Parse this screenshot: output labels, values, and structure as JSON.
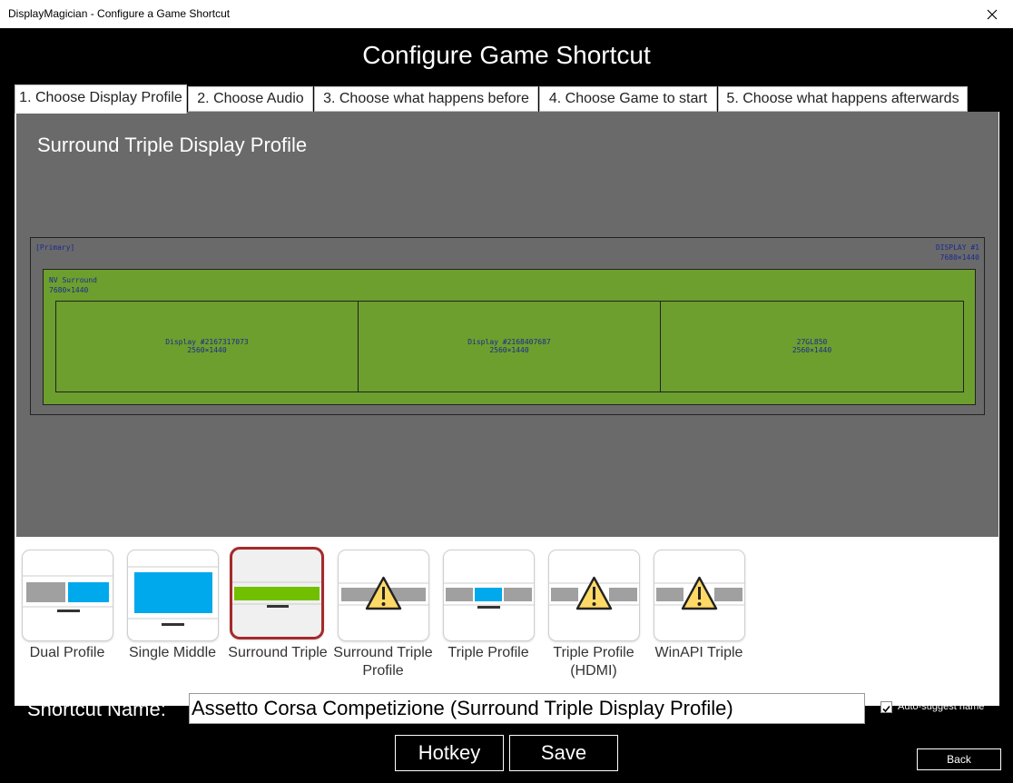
{
  "window": {
    "title": "DisplayMagician - Configure a Game Shortcut"
  },
  "heading": "Configure Game Shortcut",
  "tabs": [
    {
      "label": "1. Choose Display Profile",
      "active": true
    },
    {
      "label": "2. Choose Audio",
      "active": false
    },
    {
      "label": "3. Choose what happens before",
      "active": false
    },
    {
      "label": "4. Choose Game to start",
      "active": false
    },
    {
      "label": "5. Choose what happens afterwards",
      "active": false
    }
  ],
  "preview": {
    "profile_title": "Surround Triple Display Profile",
    "primary_tag": "[Primary]",
    "display_name": "DISPLAY #1",
    "display_res": "7680×1440",
    "surround_name": "NV Surround",
    "surround_res": "7680×1440",
    "cells": [
      {
        "name": "Display #2167317073",
        "res": "2560×1440"
      },
      {
        "name": "Display #2168407687",
        "res": "2560×1440"
      },
      {
        "name": "27GL850",
        "res": "2560×1440"
      }
    ],
    "colors": {
      "background": "#6a6a6a",
      "surround": "#6c9f2e",
      "text": "#1b2a8e"
    }
  },
  "profiles": [
    {
      "label": "Dual Profile",
      "icon": "dual-monitor-icon",
      "selected": false,
      "warning": false
    },
    {
      "label": "Single Middle",
      "icon": "single-monitor-icon",
      "selected": false,
      "warning": false
    },
    {
      "label": "Surround Triple",
      "icon": "surround-monitor-icon",
      "selected": true,
      "warning": false
    },
    {
      "label": "Surround Triple Profile",
      "icon": "warning-icon",
      "selected": false,
      "warning": true
    },
    {
      "label": "Triple Profile",
      "icon": "triple-monitor-icon",
      "selected": false,
      "warning": false
    },
    {
      "label": "Triple Profile (HDMI)",
      "icon": "warning-icon",
      "selected": false,
      "warning": true
    },
    {
      "label": "WinAPI Triple",
      "icon": "warning-icon",
      "selected": false,
      "warning": true
    }
  ],
  "shortcut": {
    "name_label": "Shortcut Name:",
    "name_value": "Assetto Corsa Competizione (Surround Triple Display Profile)",
    "auto_suggest_label": "Auto-suggest name",
    "auto_suggest_checked": true
  },
  "buttons": {
    "hotkey": "Hotkey",
    "save": "Save",
    "back": "Back"
  },
  "colors": {
    "accent_blue": "#00a8ec",
    "selected_border": "#a52a2a",
    "warning_yellow": "#ffd966"
  }
}
